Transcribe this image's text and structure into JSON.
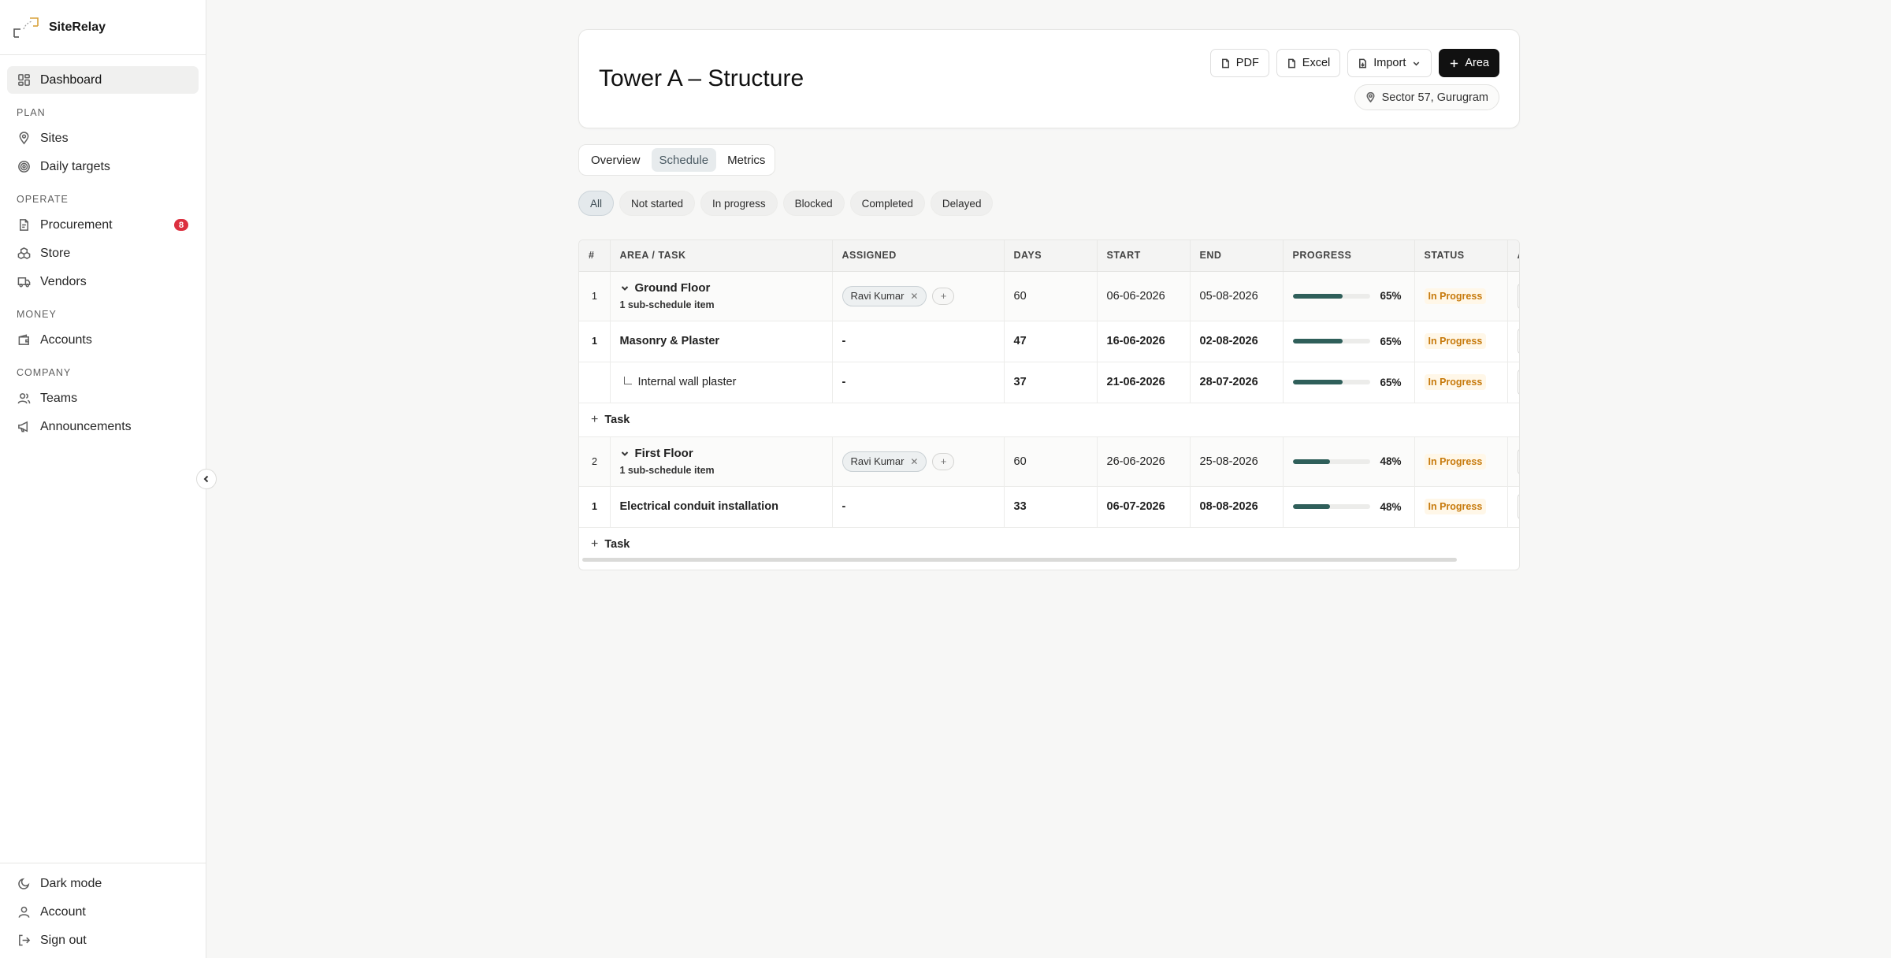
{
  "app": {
    "name": "SiteRelay"
  },
  "sidebar": {
    "dashboard": "Dashboard",
    "sections": {
      "plan": "PLAN",
      "operate": "OPERATE",
      "money": "MONEY",
      "company": "COMPANY"
    },
    "items": {
      "sites": "Sites",
      "daily_targets": "Daily targets",
      "procurement": "Procurement",
      "procurement_badge": "8",
      "store": "Store",
      "vendors": "Vendors",
      "accounts": "Accounts",
      "teams": "Teams",
      "announcements": "Announcements"
    },
    "bottom": {
      "dark_mode": "Dark mode",
      "account": "Account",
      "sign_out": "Sign out"
    }
  },
  "header": {
    "title": "Tower A – Structure",
    "pdf": "PDF",
    "excel": "Excel",
    "import": "Import",
    "add_area": "Area",
    "location": "Sector 57, Gurugram"
  },
  "tabs": [
    "Overview",
    "Schedule",
    "Metrics"
  ],
  "active_tab": "Schedule",
  "filters": [
    "All",
    "Not started",
    "In progress",
    "Blocked",
    "Completed",
    "Delayed"
  ],
  "active_filter": "All",
  "table": {
    "columns": [
      "#",
      "AREA / TASK",
      "ASSIGNED",
      "DAYS",
      "START",
      "END",
      "PROGRESS",
      "STATUS",
      "A"
    ],
    "rows": [
      {
        "kind": "area",
        "idx": "1",
        "name": "Ground Floor",
        "sub": "1 sub-schedule item",
        "assigned": "Ravi Kumar",
        "days": "60",
        "start": "06-06-2026",
        "end": "05-08-2026",
        "progress": 65,
        "progress_label": "65%",
        "status": "In Progress"
      },
      {
        "kind": "task",
        "idx": "1",
        "name": "Masonry & Plaster",
        "assigned": "-",
        "days": "47",
        "start": "16-06-2026",
        "end": "02-08-2026",
        "progress": 65,
        "progress_label": "65%",
        "status": "In Progress"
      },
      {
        "kind": "sub",
        "idx": "",
        "name": "Internal wall plaster",
        "assigned": "-",
        "days": "37",
        "start": "21-06-2026",
        "end": "28-07-2026",
        "progress": 65,
        "progress_label": "65%",
        "status": "In Progress"
      },
      {
        "kind": "add",
        "label": "Task"
      },
      {
        "kind": "area",
        "idx": "2",
        "name": "First Floor",
        "sub": "1 sub-schedule item",
        "assigned": "Ravi Kumar",
        "days": "60",
        "start": "26-06-2026",
        "end": "25-08-2026",
        "progress": 48,
        "progress_label": "48%",
        "status": "In Progress"
      },
      {
        "kind": "task",
        "idx": "1",
        "name": "Electrical conduit installation",
        "assigned": "-",
        "days": "33",
        "start": "06-07-2026",
        "end": "08-08-2026",
        "progress": 48,
        "progress_label": "48%",
        "status": "In Progress"
      },
      {
        "kind": "add",
        "label": "Task"
      }
    ]
  },
  "colors": {
    "accent": "#111111",
    "progress_fill": "#2f5f5a",
    "status_in_progress": "#c77a0c",
    "badge": "#dc2f3f"
  }
}
